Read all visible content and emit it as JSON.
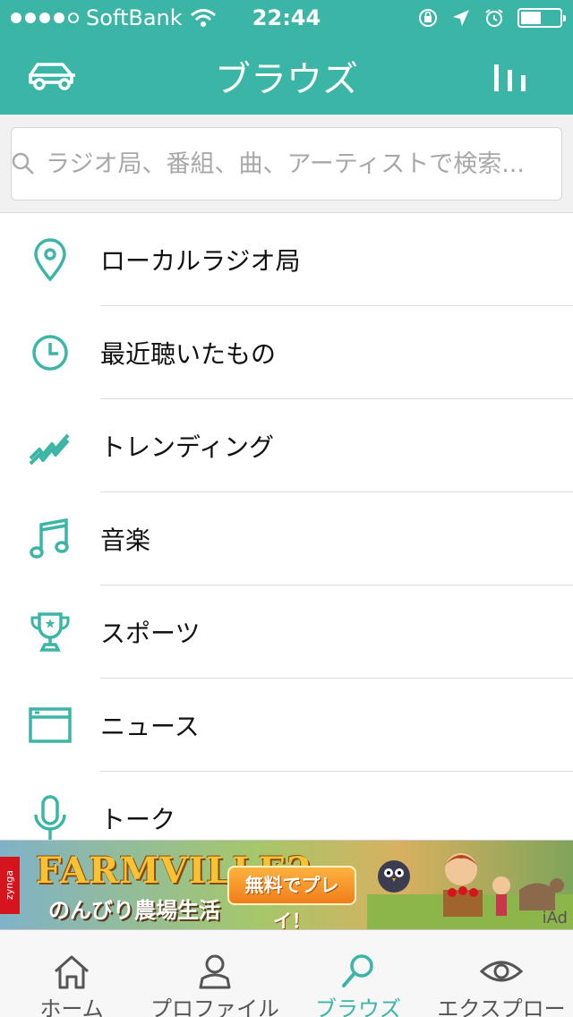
{
  "status_bar": {
    "carrier": "SoftBank",
    "time": "22:44"
  },
  "nav": {
    "title": "ブラウズ"
  },
  "search": {
    "placeholder": "ラジオ局、番組、曲、アーティストで検索..."
  },
  "menu": {
    "items": [
      {
        "label": "ローカルラジオ局",
        "icon": "location-pin-icon"
      },
      {
        "label": "最近聴いたもの",
        "icon": "clock-icon"
      },
      {
        "label": "トレンディング",
        "icon": "trending-icon"
      },
      {
        "label": "音楽",
        "icon": "music-note-icon"
      },
      {
        "label": "スポーツ",
        "icon": "trophy-icon"
      },
      {
        "label": "ニュース",
        "icon": "news-window-icon"
      },
      {
        "label": "トーク",
        "icon": "microphone-icon"
      }
    ]
  },
  "ad": {
    "brand": "zynga",
    "title": "FARMVILLE2",
    "subtitle": "のんびり農場生活",
    "cta": "無料でプレイ！",
    "iad": "iAd"
  },
  "tabs": [
    {
      "label": "ホーム",
      "icon": "home-icon"
    },
    {
      "label": "プロファイル",
      "icon": "profile-icon"
    },
    {
      "label": "ブラウズ",
      "icon": "search-icon",
      "active": true
    },
    {
      "label": "エクスプロー",
      "icon": "eye-icon"
    }
  ],
  "colors": {
    "accent": "#3bb5a5",
    "tab_inactive": "#555555"
  }
}
